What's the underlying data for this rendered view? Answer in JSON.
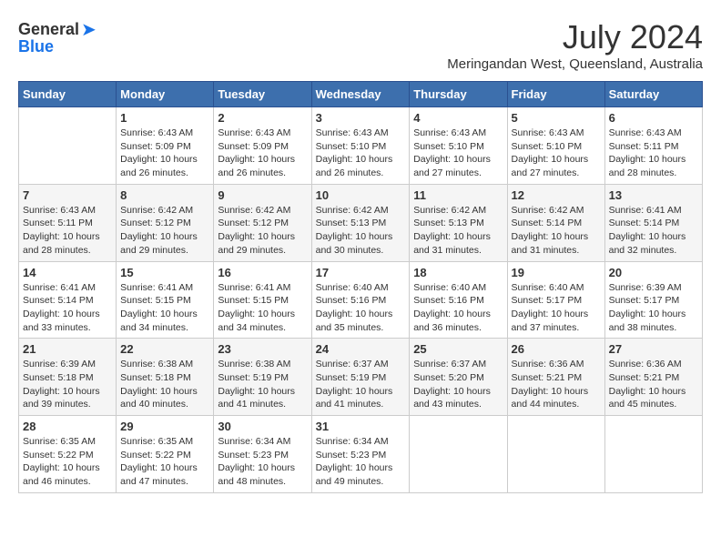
{
  "logo": {
    "general": "General",
    "blue": "Blue"
  },
  "title": {
    "month_year": "July 2024",
    "location": "Meringandan West, Queensland, Australia"
  },
  "days_of_week": [
    "Sunday",
    "Monday",
    "Tuesday",
    "Wednesday",
    "Thursday",
    "Friday",
    "Saturday"
  ],
  "weeks": [
    [
      {
        "day": "",
        "info": ""
      },
      {
        "day": "1",
        "info": "Sunrise: 6:43 AM\nSunset: 5:09 PM\nDaylight: 10 hours\nand 26 minutes."
      },
      {
        "day": "2",
        "info": "Sunrise: 6:43 AM\nSunset: 5:09 PM\nDaylight: 10 hours\nand 26 minutes."
      },
      {
        "day": "3",
        "info": "Sunrise: 6:43 AM\nSunset: 5:10 PM\nDaylight: 10 hours\nand 26 minutes."
      },
      {
        "day": "4",
        "info": "Sunrise: 6:43 AM\nSunset: 5:10 PM\nDaylight: 10 hours\nand 27 minutes."
      },
      {
        "day": "5",
        "info": "Sunrise: 6:43 AM\nSunset: 5:10 PM\nDaylight: 10 hours\nand 27 minutes."
      },
      {
        "day": "6",
        "info": "Sunrise: 6:43 AM\nSunset: 5:11 PM\nDaylight: 10 hours\nand 28 minutes."
      }
    ],
    [
      {
        "day": "7",
        "info": "Sunrise: 6:43 AM\nSunset: 5:11 PM\nDaylight: 10 hours\nand 28 minutes."
      },
      {
        "day": "8",
        "info": "Sunrise: 6:42 AM\nSunset: 5:12 PM\nDaylight: 10 hours\nand 29 minutes."
      },
      {
        "day": "9",
        "info": "Sunrise: 6:42 AM\nSunset: 5:12 PM\nDaylight: 10 hours\nand 29 minutes."
      },
      {
        "day": "10",
        "info": "Sunrise: 6:42 AM\nSunset: 5:13 PM\nDaylight: 10 hours\nand 30 minutes."
      },
      {
        "day": "11",
        "info": "Sunrise: 6:42 AM\nSunset: 5:13 PM\nDaylight: 10 hours\nand 31 minutes."
      },
      {
        "day": "12",
        "info": "Sunrise: 6:42 AM\nSunset: 5:14 PM\nDaylight: 10 hours\nand 31 minutes."
      },
      {
        "day": "13",
        "info": "Sunrise: 6:41 AM\nSunset: 5:14 PM\nDaylight: 10 hours\nand 32 minutes."
      }
    ],
    [
      {
        "day": "14",
        "info": "Sunrise: 6:41 AM\nSunset: 5:14 PM\nDaylight: 10 hours\nand 33 minutes."
      },
      {
        "day": "15",
        "info": "Sunrise: 6:41 AM\nSunset: 5:15 PM\nDaylight: 10 hours\nand 34 minutes."
      },
      {
        "day": "16",
        "info": "Sunrise: 6:41 AM\nSunset: 5:15 PM\nDaylight: 10 hours\nand 34 minutes."
      },
      {
        "day": "17",
        "info": "Sunrise: 6:40 AM\nSunset: 5:16 PM\nDaylight: 10 hours\nand 35 minutes."
      },
      {
        "day": "18",
        "info": "Sunrise: 6:40 AM\nSunset: 5:16 PM\nDaylight: 10 hours\nand 36 minutes."
      },
      {
        "day": "19",
        "info": "Sunrise: 6:40 AM\nSunset: 5:17 PM\nDaylight: 10 hours\nand 37 minutes."
      },
      {
        "day": "20",
        "info": "Sunrise: 6:39 AM\nSunset: 5:17 PM\nDaylight: 10 hours\nand 38 minutes."
      }
    ],
    [
      {
        "day": "21",
        "info": "Sunrise: 6:39 AM\nSunset: 5:18 PM\nDaylight: 10 hours\nand 39 minutes."
      },
      {
        "day": "22",
        "info": "Sunrise: 6:38 AM\nSunset: 5:18 PM\nDaylight: 10 hours\nand 40 minutes."
      },
      {
        "day": "23",
        "info": "Sunrise: 6:38 AM\nSunset: 5:19 PM\nDaylight: 10 hours\nand 41 minutes."
      },
      {
        "day": "24",
        "info": "Sunrise: 6:37 AM\nSunset: 5:19 PM\nDaylight: 10 hours\nand 41 minutes."
      },
      {
        "day": "25",
        "info": "Sunrise: 6:37 AM\nSunset: 5:20 PM\nDaylight: 10 hours\nand 43 minutes."
      },
      {
        "day": "26",
        "info": "Sunrise: 6:36 AM\nSunset: 5:21 PM\nDaylight: 10 hours\nand 44 minutes."
      },
      {
        "day": "27",
        "info": "Sunrise: 6:36 AM\nSunset: 5:21 PM\nDaylight: 10 hours\nand 45 minutes."
      }
    ],
    [
      {
        "day": "28",
        "info": "Sunrise: 6:35 AM\nSunset: 5:22 PM\nDaylight: 10 hours\nand 46 minutes."
      },
      {
        "day": "29",
        "info": "Sunrise: 6:35 AM\nSunset: 5:22 PM\nDaylight: 10 hours\nand 47 minutes."
      },
      {
        "day": "30",
        "info": "Sunrise: 6:34 AM\nSunset: 5:23 PM\nDaylight: 10 hours\nand 48 minutes."
      },
      {
        "day": "31",
        "info": "Sunrise: 6:34 AM\nSunset: 5:23 PM\nDaylight: 10 hours\nand 49 minutes."
      },
      {
        "day": "",
        "info": ""
      },
      {
        "day": "",
        "info": ""
      },
      {
        "day": "",
        "info": ""
      }
    ]
  ]
}
